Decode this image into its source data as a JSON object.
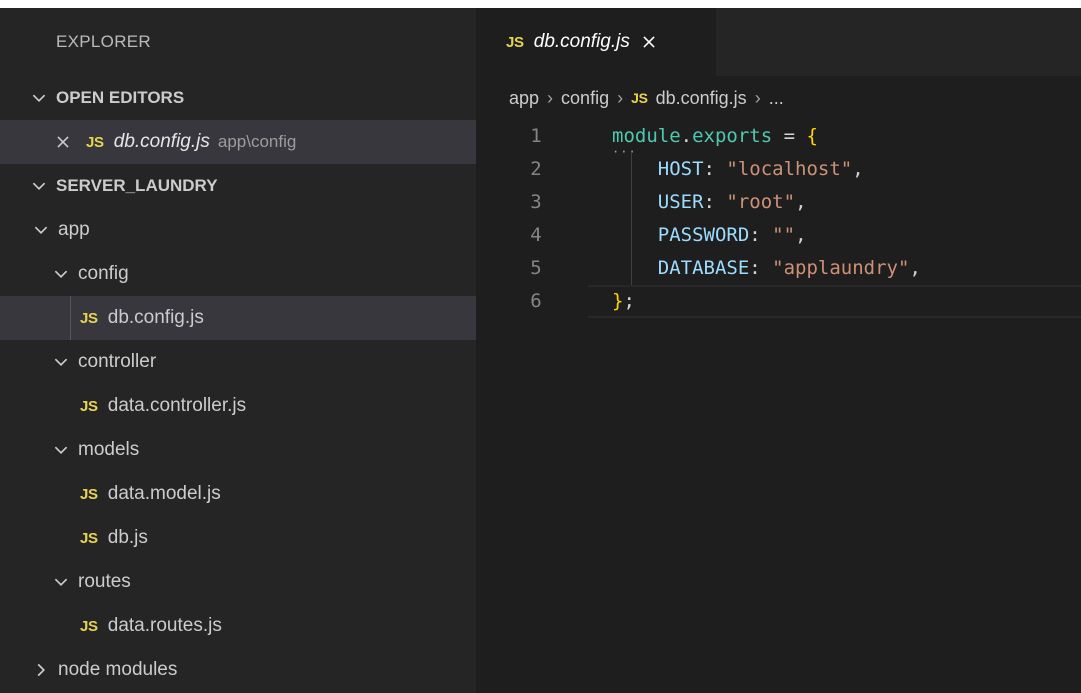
{
  "sidebar": {
    "title": "EXPLORER",
    "open_editors": {
      "label": "OPEN EDITORS",
      "items": [
        {
          "badge": "JS",
          "name": "db.config.js",
          "path": "app\\config"
        }
      ]
    },
    "project": {
      "label": "SERVER_LAUNDRY",
      "tree": [
        {
          "type": "folder",
          "name": "app",
          "depth": 1,
          "expanded": true
        },
        {
          "type": "folder",
          "name": "config",
          "depth": 2,
          "expanded": true
        },
        {
          "type": "file",
          "badge": "JS",
          "name": "db.config.js",
          "depth": 3,
          "selected": true
        },
        {
          "type": "folder",
          "name": "controller",
          "depth": 2,
          "expanded": true
        },
        {
          "type": "file",
          "badge": "JS",
          "name": "data.controller.js",
          "depth": 3
        },
        {
          "type": "folder",
          "name": "models",
          "depth": 2,
          "expanded": true
        },
        {
          "type": "file",
          "badge": "JS",
          "name": "data.model.js",
          "depth": 3
        },
        {
          "type": "file",
          "badge": "JS",
          "name": "db.js",
          "depth": 3
        },
        {
          "type": "folder",
          "name": "routes",
          "depth": 2,
          "expanded": true
        },
        {
          "type": "file",
          "badge": "JS",
          "name": "data.routes.js",
          "depth": 3
        },
        {
          "type": "folder",
          "name": "node modules",
          "depth": 1,
          "expanded": false
        }
      ]
    }
  },
  "editor": {
    "tab": {
      "badge": "JS",
      "name": "db.config.js"
    },
    "breadcrumb": {
      "parts": [
        "app",
        "config"
      ],
      "badge": "JS",
      "file": "db.config.js",
      "more": "..."
    },
    "lines": [
      {
        "number": "1",
        "tokens": [
          {
            "t": "var",
            "v": "module"
          },
          {
            "t": "punc",
            "v": "."
          },
          {
            "t": "var",
            "v": "exports"
          },
          {
            "t": "punc",
            "v": " = "
          },
          {
            "t": "brace",
            "v": "{"
          }
        ]
      },
      {
        "number": "2",
        "tokens": [
          {
            "t": "punc",
            "v": "    "
          },
          {
            "t": "prop",
            "v": "HOST"
          },
          {
            "t": "punc",
            "v": ": "
          },
          {
            "t": "str",
            "v": "\"localhost\""
          },
          {
            "t": "punc",
            "v": ","
          }
        ]
      },
      {
        "number": "3",
        "tokens": [
          {
            "t": "punc",
            "v": "    "
          },
          {
            "t": "prop",
            "v": "USER"
          },
          {
            "t": "punc",
            "v": ": "
          },
          {
            "t": "str",
            "v": "\"root\""
          },
          {
            "t": "punc",
            "v": ","
          }
        ]
      },
      {
        "number": "4",
        "tokens": [
          {
            "t": "punc",
            "v": "    "
          },
          {
            "t": "prop",
            "v": "PASSWORD"
          },
          {
            "t": "punc",
            "v": ": "
          },
          {
            "t": "str",
            "v": "\"\""
          },
          {
            "t": "punc",
            "v": ","
          }
        ]
      },
      {
        "number": "5",
        "tokens": [
          {
            "t": "punc",
            "v": "    "
          },
          {
            "t": "prop",
            "v": "DATABASE"
          },
          {
            "t": "punc",
            "v": ": "
          },
          {
            "t": "str",
            "v": "\"applaundry\""
          },
          {
            "t": "punc",
            "v": ","
          }
        ]
      },
      {
        "number": "6",
        "tokens": [
          {
            "t": "brace",
            "v": "}"
          },
          {
            "t": "punc",
            "v": ";"
          }
        ]
      }
    ]
  },
  "colors": {
    "sidebar_bg": "#252526",
    "editor_bg": "#1e1e1e",
    "selection_bg": "#37373d",
    "js_badge": "#e8d44d",
    "string": "#ce9178",
    "property": "#9cdcfe",
    "variable": "#4ec9b0",
    "bracket": "#ffd700"
  }
}
